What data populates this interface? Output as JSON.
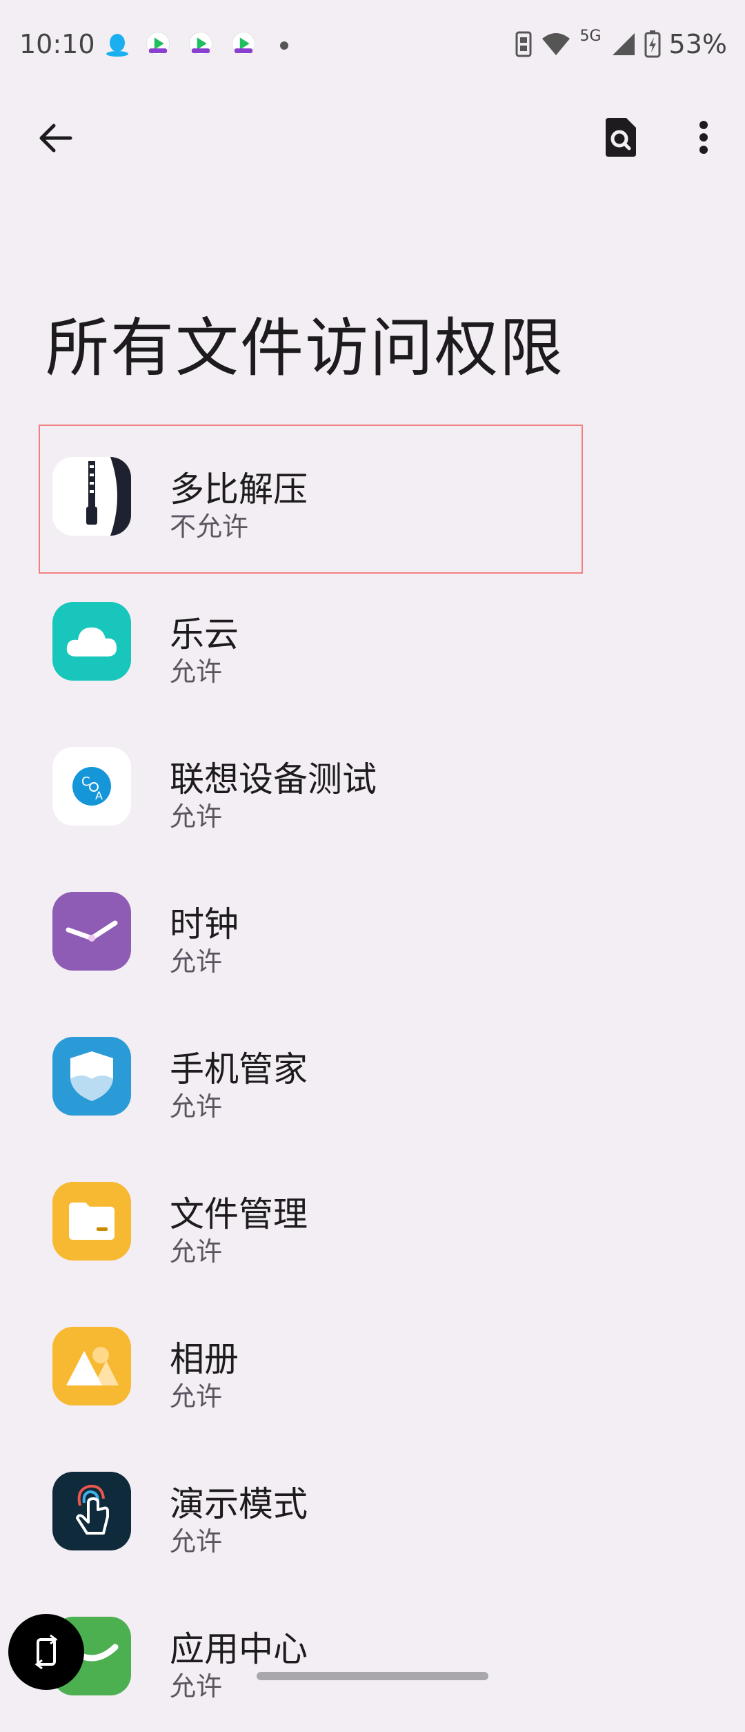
{
  "status_bar": {
    "time": "10:10",
    "network": "5G",
    "battery": "53%"
  },
  "header": {
    "title": "所有文件访问权限"
  },
  "apps": [
    {
      "name": "多比解压",
      "status": "不允许",
      "icon": "zip-archive-icon",
      "color": "#ffffff"
    },
    {
      "name": "乐云",
      "status": "允许",
      "icon": "cloud-icon",
      "color": "#18c6bc"
    },
    {
      "name": "联想设备测试",
      "status": "允许",
      "icon": "coa-test-icon",
      "color": "#ffffff"
    },
    {
      "name": "时钟",
      "status": "允许",
      "icon": "clock-icon",
      "color": "#8e5bb5"
    },
    {
      "name": "手机管家",
      "status": "允许",
      "icon": "shield-icon",
      "color": "#2a9bd7"
    },
    {
      "name": "文件管理",
      "status": "允许",
      "icon": "folder-icon",
      "color": "#f7b932"
    },
    {
      "name": "相册",
      "status": "允许",
      "icon": "gallery-icon",
      "color": "#f7b932"
    },
    {
      "name": "演示模式",
      "status": "允许",
      "icon": "touch-hand-icon",
      "color": "#0e2a3b"
    },
    {
      "name": "应用中心",
      "status": "允许",
      "icon": "app-center-icon",
      "color": "#4caf50"
    }
  ]
}
